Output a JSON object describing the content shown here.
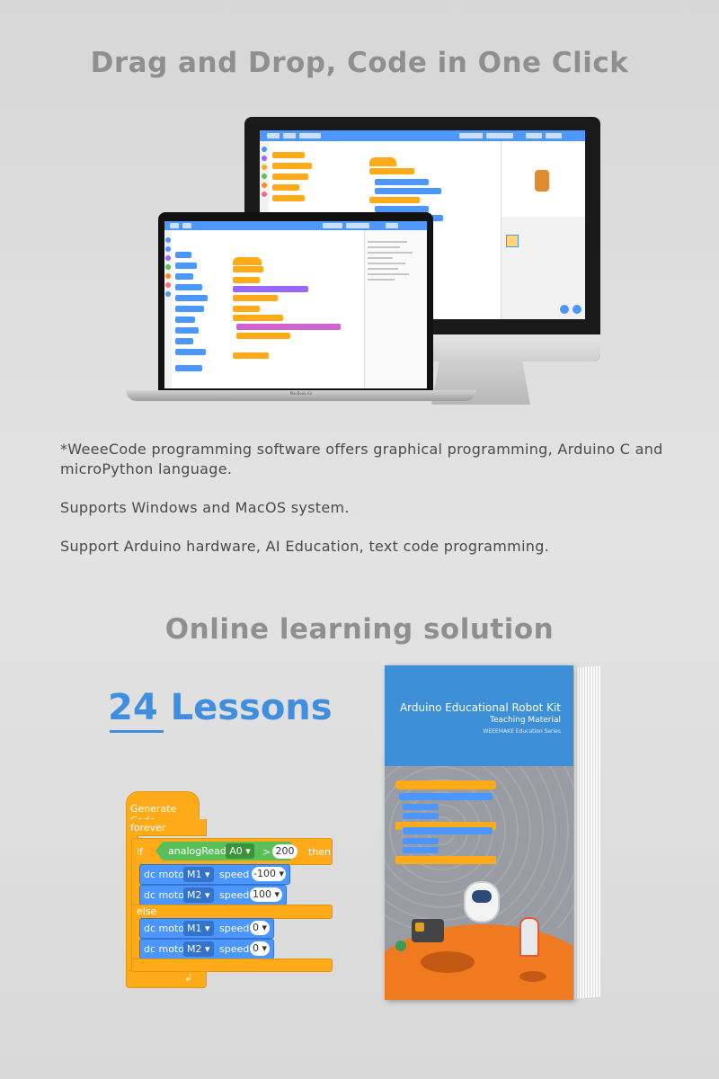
{
  "headings": {
    "title1": "Drag and Drop, Code in One Click",
    "title2": "Online learning solution"
  },
  "paragraphs": {
    "p1": "*WeeeCode programming software offers graphical programming, Arduino C and microPython language.",
    "p2": "Supports Windows and MacOS system.",
    "p3": "Support Arduino hardware, AI Education, text code programming."
  },
  "devices": {
    "laptop_label": "MacBook Air"
  },
  "lessons": {
    "label": "24 Lessons"
  },
  "code": {
    "hat": "Generate Code",
    "forever": "forever",
    "if": "if",
    "analog": "analogRead",
    "pin": "A0 ▾",
    "op": ">",
    "threshold": "200",
    "then": "then",
    "else": "else",
    "rows": [
      {
        "label": "dc motor",
        "motor": "M1 ▾",
        "speed_label": "speed",
        "speed": "-100 ▾"
      },
      {
        "label": "dc motor",
        "motor": "M2 ▾",
        "speed_label": "speed",
        "speed": "100 ▾"
      },
      {
        "label": "dc motor",
        "motor": "M1 ▾",
        "speed_label": "speed",
        "speed": "0 ▾"
      },
      {
        "label": "dc motor",
        "motor": "M2 ▾",
        "speed_label": "speed",
        "speed": "0 ▾"
      }
    ]
  },
  "book": {
    "title": "Arduino Educational Robot Kit",
    "subtitle": "Teaching Material",
    "series": "WEEEMAKE Education Series"
  },
  "colors": {
    "accent": "#3f8ee0",
    "block_orange": "#ffab19",
    "block_blue": "#4c97ff",
    "block_green": "#59c059"
  }
}
